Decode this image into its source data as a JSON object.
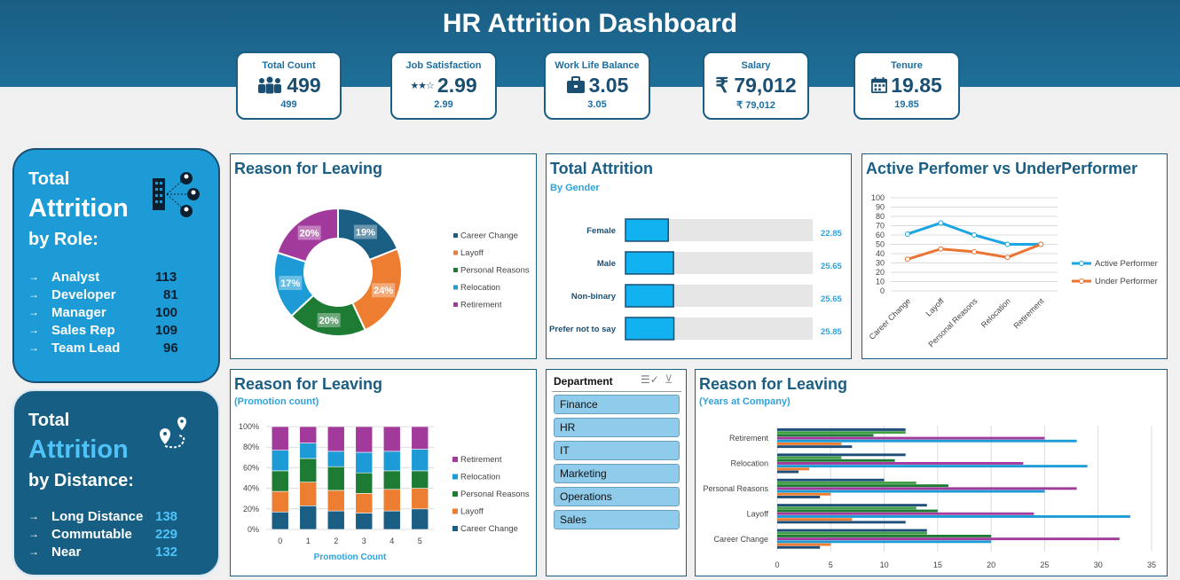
{
  "title": "HR Attrition Dashboard",
  "kpis": [
    {
      "label": "Total Count",
      "value": "499",
      "sub": "499",
      "icon": "people-icon"
    },
    {
      "label": "Job Satisfaction",
      "value": "2.99",
      "sub": "2.99",
      "icon": "stars-icon"
    },
    {
      "label": "Work Life Balance",
      "value": "3.05",
      "sub": "3.05",
      "icon": "briefcase-icon"
    },
    {
      "label": "Salary",
      "value": "₹ 79,012",
      "sub": "₹ 79,012",
      "icon": "none"
    },
    {
      "label": "Tenure",
      "value": "19.85",
      "sub": "19.85",
      "icon": "calendar-icon"
    }
  ],
  "role_card": {
    "line1": "Total",
    "line2": "Attrition",
    "line3": "by Role:",
    "items": [
      {
        "name": "Analyst",
        "value": "113"
      },
      {
        "name": "Developer",
        "value": "81"
      },
      {
        "name": "Manager",
        "value": "100"
      },
      {
        "name": "Sales Rep",
        "value": "109"
      },
      {
        "name": "Team Lead",
        "value": "96"
      }
    ]
  },
  "distance_card": {
    "line1": "Total",
    "line2": "Attrition",
    "line3": "by Distance:",
    "items": [
      {
        "name": "Long Distance",
        "value": "138"
      },
      {
        "name": "Commutable",
        "value": "229"
      },
      {
        "name": "Near",
        "value": "132"
      }
    ]
  },
  "panels": {
    "reason": {
      "title": "Reason for Leaving"
    },
    "gender": {
      "title": "Total Attrition",
      "subtitle": "By Gender"
    },
    "performer": {
      "title": "Active Perfomer vs UnderPerformer"
    },
    "promotion": {
      "title": "Reason for Leaving",
      "subtitle": "(Promotion count)"
    },
    "years": {
      "title": "Reason for Leaving",
      "subtitle": "(Years at Company)"
    }
  },
  "slicer": {
    "title": "Department",
    "items": [
      "Finance",
      "HR",
      "IT",
      "Marketing",
      "Operations",
      "Sales"
    ]
  },
  "chart_data": [
    {
      "id": "reason_donut",
      "type": "pie",
      "categories": [
        "Career Change",
        "Layoff",
        "Personal Reasons",
        "Relocation",
        "Retirement"
      ],
      "values": [
        19,
        24,
        20,
        17,
        20
      ],
      "labels": [
        "19%",
        "24%",
        "20%",
        "17%",
        "20%"
      ],
      "colors": [
        "#1b5e84",
        "#ed7d31",
        "#1e7b34",
        "#1d9bd6",
        "#a23a9c"
      ],
      "legend": "right"
    },
    {
      "id": "gender_bar",
      "type": "bar",
      "orientation": "horizontal",
      "categories": [
        "Female",
        "Male",
        "Non-binary",
        "Prefer not to say"
      ],
      "values": [
        22.85,
        25.65,
        25.65,
        25.85
      ],
      "value_labels": [
        "22.85",
        "25.65",
        "25.65",
        "25.85"
      ],
      "xlim": [
        0,
        100
      ],
      "color": "#12b1f0"
    },
    {
      "id": "performer_line",
      "type": "line",
      "categories": [
        "Career Change",
        "Layoff",
        "Personal Reasons",
        "Relocation",
        "Retirement"
      ],
      "series": [
        {
          "name": "Active Performer",
          "values": [
            61,
            73,
            60,
            50,
            50
          ],
          "color": "#1aa5e3"
        },
        {
          "name": "Under Performer",
          "values": [
            34,
            45,
            42,
            36,
            50
          ],
          "color": "#ea7431"
        }
      ],
      "ylim": [
        0,
        100
      ],
      "yticks": [
        "100",
        "90",
        "80",
        "70",
        "60",
        "50",
        "40",
        "30",
        "20",
        "10",
        "0"
      ],
      "legend": "right"
    },
    {
      "id": "promotion_stacked",
      "type": "bar",
      "stacked": "percent",
      "categories": [
        "0",
        "1",
        "2",
        "3",
        "4",
        "5"
      ],
      "xlabel": "Promotion Count",
      "yticks": [
        "100%",
        "80%",
        "60%",
        "40%",
        "20%",
        "0%"
      ],
      "series": [
        {
          "name": "Career Change",
          "values": [
            17,
            23,
            18,
            16,
            18,
            20
          ],
          "color": "#1b5e84"
        },
        {
          "name": "Layoff",
          "values": [
            20,
            23,
            20,
            19,
            21,
            20
          ],
          "color": "#ed7d31"
        },
        {
          "name": "Personal Reasons",
          "values": [
            20,
            23,
            23,
            20,
            18,
            17
          ],
          "color": "#1e7b34"
        },
        {
          "name": "Relocation",
          "values": [
            20,
            15,
            15,
            20,
            19,
            21
          ],
          "color": "#1d9bd6"
        },
        {
          "name": "Retirement",
          "values": [
            23,
            16,
            24,
            25,
            24,
            22
          ],
          "color": "#a23a9c"
        }
      ],
      "legend_order": [
        "Retirement",
        "Relocation",
        "Personal Reasons",
        "Layoff",
        "Career Change"
      ],
      "legend": "right"
    },
    {
      "id": "years_grouped",
      "type": "bar",
      "orientation": "horizontal",
      "categories": [
        "Retirement",
        "Relocation",
        "Personal Reasons",
        "Layoff",
        "Career Change"
      ],
      "xticks": [
        "0",
        "5",
        "10",
        "15",
        "20",
        "25",
        "30",
        "35"
      ],
      "xlim": [
        0,
        35
      ],
      "bar_colors": [
        "#1f4e79",
        "#43a047",
        "#1e7b34",
        "#a23a9c",
        "#1d9bd6",
        "#ed7d31",
        "#1f4e79"
      ],
      "values": {
        "Retirement": [
          12,
          12,
          9,
          25,
          28,
          6,
          7
        ],
        "Relocation": [
          12,
          6,
          11,
          23,
          29,
          3,
          2
        ],
        "Personal Reasons": [
          10,
          13,
          16,
          28,
          25,
          5,
          4
        ],
        "Layoff": [
          14,
          13,
          15,
          24,
          33,
          7,
          12
        ],
        "Career Change": [
          14,
          14,
          20,
          32,
          20,
          5,
          4
        ]
      }
    }
  ]
}
